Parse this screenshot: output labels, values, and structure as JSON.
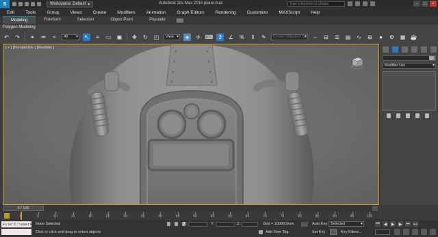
{
  "window": {
    "workspace_label": "Workspace: Default",
    "title": "Autodesk 3ds Max 2015   plane.max",
    "search_placeholder": "Type a keyword or phrase"
  },
  "menu": [
    "Edit",
    "Tools",
    "Group",
    "Views",
    "Create",
    "Modifiers",
    "Animation",
    "Graph Editors",
    "Rendering",
    "Customize",
    "MAXScript",
    "Help"
  ],
  "ribbon": {
    "tabs": [
      "Modeling",
      "Freeform",
      "Selection",
      "Object Paint",
      "Populate"
    ],
    "active_tab": "Modeling",
    "sub_label": "Polygon Modeling"
  },
  "toolbar": {
    "filter_value": "All",
    "refcoord_value": "View",
    "named_sel_placeholder": "Create Selection Se"
  },
  "viewport": {
    "label": "[ + ] [Perspective ] [Realistic ]"
  },
  "command_panel": {
    "modifier_list": "Modifier List"
  },
  "timeline": {
    "frame_readout": "0 / 100",
    "ticks": [
      "0",
      "5",
      "10",
      "15",
      "20",
      "25",
      "30",
      "35",
      "40",
      "45",
      "50",
      "55",
      "60",
      "65",
      "70",
      "75",
      "80",
      "85",
      "90",
      "95",
      "100"
    ]
  },
  "status": {
    "listener_text": "File:C:\\Users",
    "selection": "None Selected",
    "prompt": "Click or click-and-drag to select objects",
    "x_label": "X:",
    "y_label": "Y:",
    "z_label": "Z:",
    "grid": "Grid = 10000,0mm",
    "add_time_tag": "Add Time Tag",
    "auto_key": "Auto Key",
    "set_key": "Set Key",
    "selected_value": "Selected",
    "key_filters": "Key Filters..."
  }
}
